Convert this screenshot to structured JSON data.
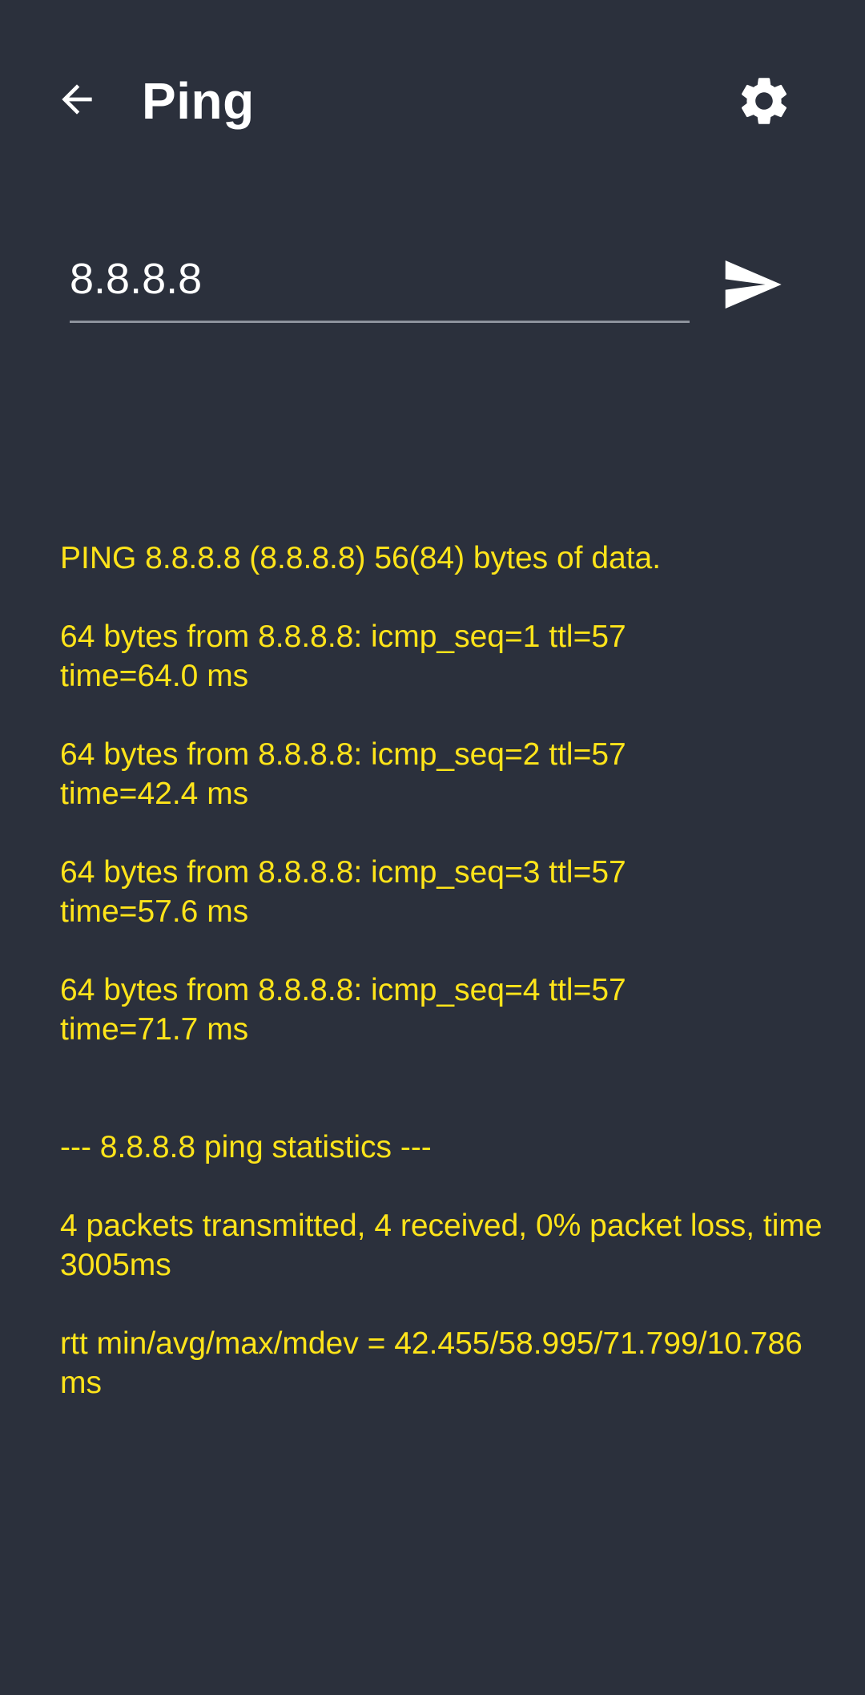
{
  "header": {
    "title": "Ping",
    "back_icon": "arrow-back-icon",
    "settings_icon": "gear-icon"
  },
  "host": {
    "value": "8.8.8.8",
    "send_icon": "send-icon"
  },
  "output": {
    "header_line": "PING 8.8.8.8 (8.8.8.8) 56(84) bytes of data.",
    "replies": [
      "64 bytes from 8.8.8.8: icmp_seq=1 ttl=57 time=64.0 ms",
      "64 bytes from 8.8.8.8: icmp_seq=2 ttl=57 time=42.4 ms",
      "64 bytes from 8.8.8.8: icmp_seq=3 ttl=57 time=57.6 ms",
      "64 bytes from 8.8.8.8: icmp_seq=4 ttl=57 time=71.7 ms"
    ],
    "stats_header": "--- 8.8.8.8 ping statistics ---",
    "stats_summary": "4 packets transmitted, 4 received, 0% packet loss, time 3005ms",
    "rtt": "rtt min/avg/max/mdev = 42.455/58.995/71.799/10.786 ms"
  },
  "colors": {
    "background": "#2b303c",
    "output_text": "#ffe41a",
    "foreground": "#ffffff",
    "underline": "#8d929c"
  }
}
